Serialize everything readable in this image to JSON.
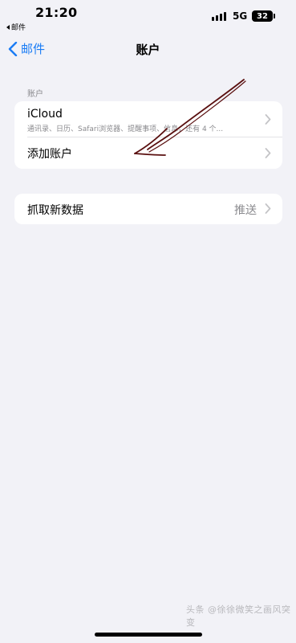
{
  "status_bar": {
    "time": "21:20",
    "back_app": "邮件",
    "network": "5G",
    "battery": "32"
  },
  "nav": {
    "back_label": "邮件",
    "title": "账户"
  },
  "accounts_section": {
    "header": "账户",
    "icloud": {
      "title": "iCloud",
      "subtitle": "通讯录、日历、Safari浏览器、提醒事项、信息，还有 4 个..."
    },
    "add_account": "添加账户"
  },
  "fetch": {
    "label": "抓取新数据",
    "value": "推送"
  },
  "watermark": "头条 @徐徐微笑之画风突变",
  "colors": {
    "accent": "#1a7cf5",
    "background": "#f2f2f7",
    "annotation": "#5a1010"
  }
}
